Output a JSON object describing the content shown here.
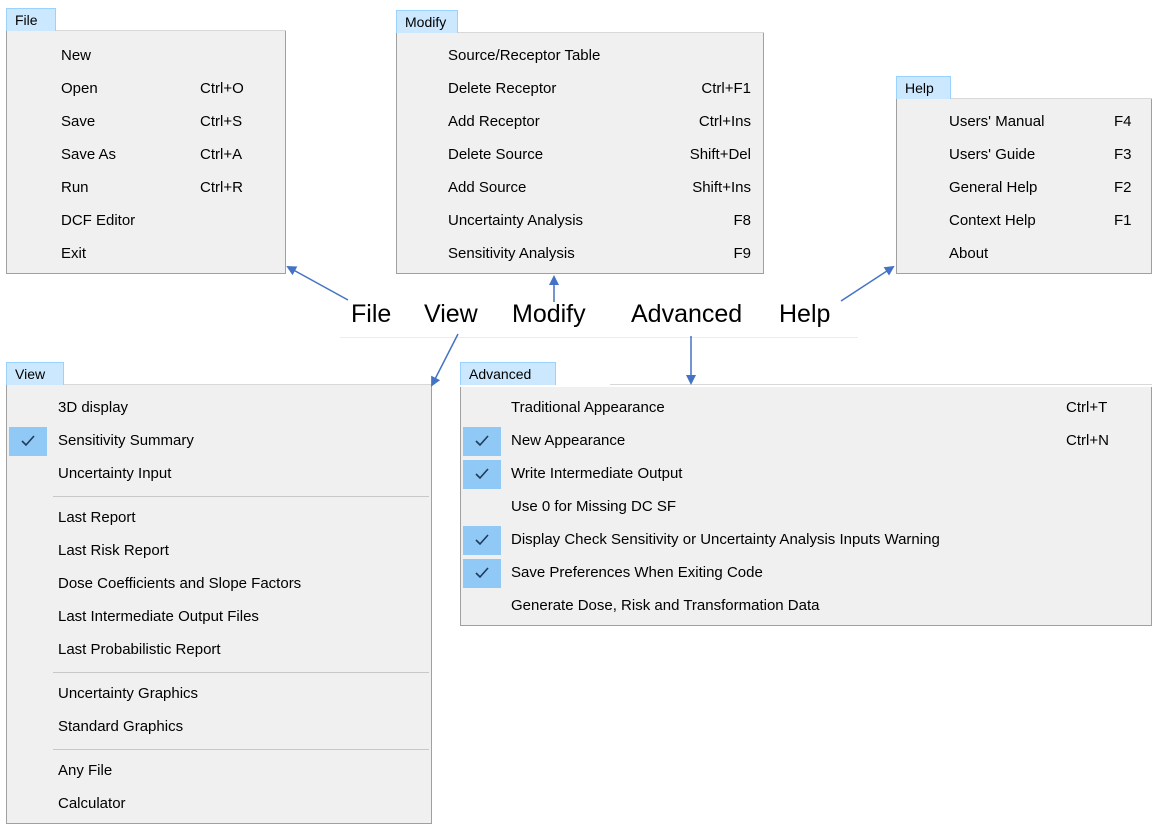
{
  "file_menu": {
    "tab": "File",
    "items": [
      {
        "label": "New",
        "shortcut": ""
      },
      {
        "label": "Open",
        "shortcut": "Ctrl+O"
      },
      {
        "label": "Save",
        "shortcut": "Ctrl+S"
      },
      {
        "label": "Save As",
        "shortcut": "Ctrl+A"
      },
      {
        "label": "Run",
        "shortcut": "Ctrl+R"
      },
      {
        "label": "DCF Editor",
        "shortcut": ""
      },
      {
        "label": "Exit",
        "shortcut": ""
      }
    ]
  },
  "modify_menu": {
    "tab": "Modify",
    "items": [
      {
        "label": "Source/Receptor Table",
        "shortcut": ""
      },
      {
        "label": "Delete Receptor",
        "shortcut": "Ctrl+F1"
      },
      {
        "label": "Add Receptor",
        "shortcut": "Ctrl+Ins"
      },
      {
        "label": "Delete Source",
        "shortcut": "Shift+Del"
      },
      {
        "label": "Add Source",
        "shortcut": "Shift+Ins"
      },
      {
        "label": "Uncertainty Analysis",
        "shortcut": "F8"
      },
      {
        "label": "Sensitivity Analysis",
        "shortcut": "F9"
      }
    ]
  },
  "help_menu": {
    "tab": "Help",
    "items": [
      {
        "label": "Users' Manual",
        "shortcut": "F4"
      },
      {
        "label": "Users' Guide",
        "shortcut": "F3"
      },
      {
        "label": "General Help",
        "shortcut": "F2"
      },
      {
        "label": "Context Help",
        "shortcut": "F1"
      },
      {
        "label": "About",
        "shortcut": ""
      }
    ]
  },
  "menubar": {
    "file": "File",
    "view": "View",
    "modify": "Modify",
    "advanced": "Advanced",
    "help": "Help"
  },
  "view_menu": {
    "tab": "View",
    "items": [
      {
        "label": "3D display",
        "checked": false
      },
      {
        "label": "Sensitivity Summary",
        "checked": true
      },
      {
        "label": "Uncertainty Input",
        "checked": false
      },
      {
        "label": "Last Report",
        "checked": false
      },
      {
        "label": "Last Risk Report",
        "checked": false
      },
      {
        "label": "Dose Coefficients and Slope Factors",
        "checked": false
      },
      {
        "label": "Last Intermediate Output Files",
        "checked": false
      },
      {
        "label": "Last Probabilistic Report",
        "checked": false
      },
      {
        "label": "Uncertainty Graphics",
        "checked": false
      },
      {
        "label": "Standard Graphics",
        "checked": false
      },
      {
        "label": "Any File",
        "checked": false
      },
      {
        "label": "Calculator",
        "checked": false
      }
    ]
  },
  "advanced_menu": {
    "tab": "Advanced",
    "items": [
      {
        "label": "Traditional Appearance",
        "shortcut": "Ctrl+T",
        "checked": false
      },
      {
        "label": "New Appearance",
        "shortcut": "Ctrl+N",
        "checked": true
      },
      {
        "label": "Write Intermediate Output",
        "shortcut": "",
        "checked": true
      },
      {
        "label": "Use 0 for Missing DC SF",
        "shortcut": "",
        "checked": false
      },
      {
        "label": "Display Check Sensitivity or Uncertainty Analysis Inputs Warning",
        "shortcut": "",
        "checked": true
      },
      {
        "label": "Save Preferences When  Exiting Code",
        "shortcut": "",
        "checked": true
      },
      {
        "label": "Generate Dose, Risk and Transformation Data",
        "shortcut": "",
        "checked": false
      }
    ]
  },
  "colors": {
    "menu_bg": "#f0f0f0",
    "tab_bg": "#cce8ff",
    "check_bg": "#90c8f6",
    "arrow": "#4472c4"
  }
}
